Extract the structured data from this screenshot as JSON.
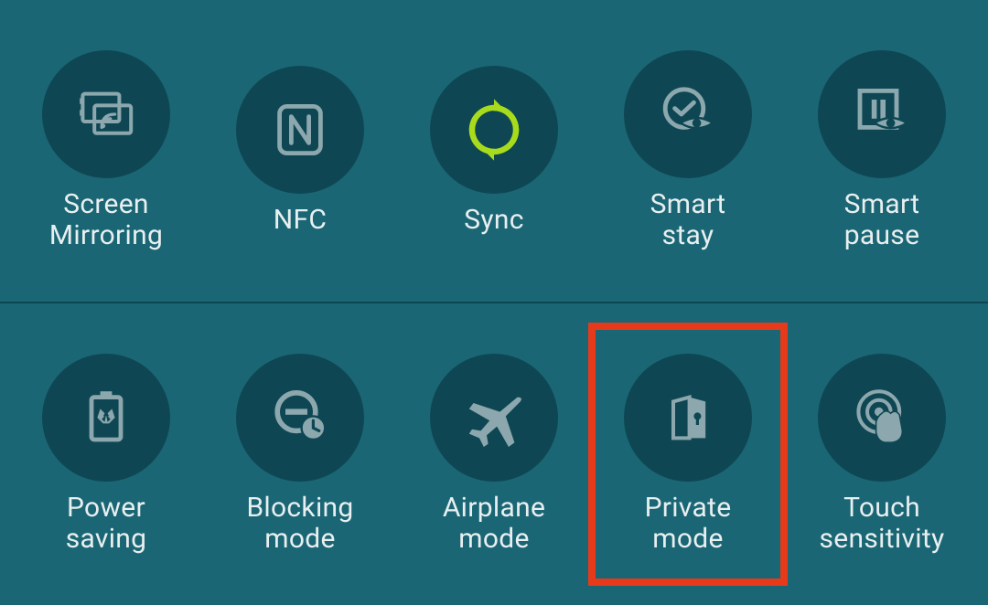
{
  "quick_settings": {
    "rows": [
      {
        "items": [
          {
            "id": "screen-mirroring",
            "label": "Screen\nMirroring",
            "active": false,
            "highlighted": false
          },
          {
            "id": "nfc",
            "label": "NFC",
            "active": false,
            "highlighted": false
          },
          {
            "id": "sync",
            "label": "Sync",
            "active": true,
            "highlighted": false
          },
          {
            "id": "smart-stay",
            "label": "Smart\nstay",
            "active": false,
            "highlighted": false
          },
          {
            "id": "smart-pause",
            "label": "Smart\npause",
            "active": false,
            "highlighted": false
          }
        ]
      },
      {
        "items": [
          {
            "id": "power-saving",
            "label": "Power\nsaving",
            "active": false,
            "highlighted": false
          },
          {
            "id": "blocking-mode",
            "label": "Blocking\nmode",
            "active": false,
            "highlighted": false
          },
          {
            "id": "airplane-mode",
            "label": "Airplane\nmode",
            "active": false,
            "highlighted": false
          },
          {
            "id": "private-mode",
            "label": "Private\nmode",
            "active": false,
            "highlighted": true
          },
          {
            "id": "touch-sensitivity",
            "label": "Touch\nsensitivity",
            "active": false,
            "highlighted": false
          }
        ]
      }
    ]
  },
  "colors": {
    "bg": "#1a6674",
    "circle": "#0e4753",
    "text": "#e8eff0",
    "inactive": "#8ca8ae",
    "active": "#a7db1c",
    "highlight": "#e63a1a"
  }
}
